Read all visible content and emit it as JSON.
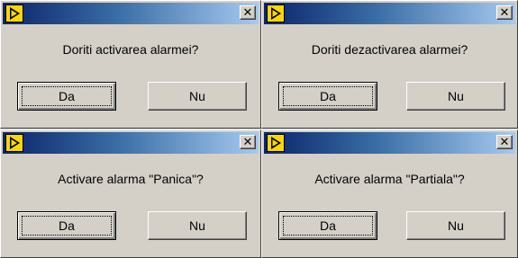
{
  "dialogs": [
    {
      "message": "Doriti activarea alarmei?",
      "yes_label": "Da",
      "no_label": "Nu",
      "close_label": "✕"
    },
    {
      "message": "Doriti dezactivarea alarmei?",
      "yes_label": "Da",
      "no_label": "Nu",
      "close_label": "✕"
    },
    {
      "message": "Activare alarma \"Panica\"?",
      "yes_label": "Da",
      "no_label": "Nu",
      "close_label": "✕"
    },
    {
      "message": "Activare alarma \"Partiala\"?",
      "yes_label": "Da",
      "no_label": "Nu",
      "close_label": "✕"
    }
  ],
  "icons": {
    "app": "labview-run-icon",
    "close": "close-icon"
  },
  "colors": {
    "titlebar_start": "#0a246a",
    "titlebar_end": "#a6caf0",
    "window_bg": "#d4d0c8"
  }
}
